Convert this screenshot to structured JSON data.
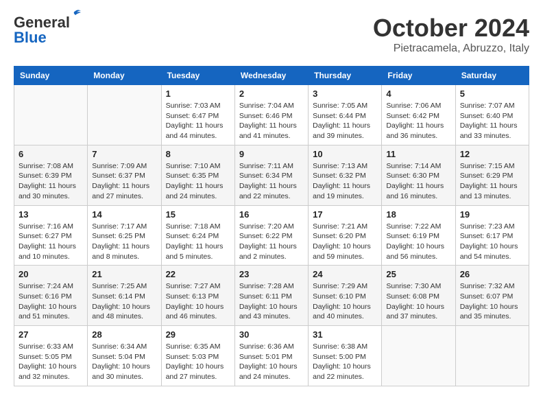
{
  "header": {
    "logo_line1": "General",
    "logo_line2": "Blue",
    "month": "October 2024",
    "location": "Pietracamela, Abruzzo, Italy"
  },
  "weekdays": [
    "Sunday",
    "Monday",
    "Tuesday",
    "Wednesday",
    "Thursday",
    "Friday",
    "Saturday"
  ],
  "weeks": [
    [
      {
        "day": "",
        "info": ""
      },
      {
        "day": "",
        "info": ""
      },
      {
        "day": "1",
        "info": "Sunrise: 7:03 AM\nSunset: 6:47 PM\nDaylight: 11 hours and 44 minutes."
      },
      {
        "day": "2",
        "info": "Sunrise: 7:04 AM\nSunset: 6:46 PM\nDaylight: 11 hours and 41 minutes."
      },
      {
        "day": "3",
        "info": "Sunrise: 7:05 AM\nSunset: 6:44 PM\nDaylight: 11 hours and 39 minutes."
      },
      {
        "day": "4",
        "info": "Sunrise: 7:06 AM\nSunset: 6:42 PM\nDaylight: 11 hours and 36 minutes."
      },
      {
        "day": "5",
        "info": "Sunrise: 7:07 AM\nSunset: 6:40 PM\nDaylight: 11 hours and 33 minutes."
      }
    ],
    [
      {
        "day": "6",
        "info": "Sunrise: 7:08 AM\nSunset: 6:39 PM\nDaylight: 11 hours and 30 minutes."
      },
      {
        "day": "7",
        "info": "Sunrise: 7:09 AM\nSunset: 6:37 PM\nDaylight: 11 hours and 27 minutes."
      },
      {
        "day": "8",
        "info": "Sunrise: 7:10 AM\nSunset: 6:35 PM\nDaylight: 11 hours and 24 minutes."
      },
      {
        "day": "9",
        "info": "Sunrise: 7:11 AM\nSunset: 6:34 PM\nDaylight: 11 hours and 22 minutes."
      },
      {
        "day": "10",
        "info": "Sunrise: 7:13 AM\nSunset: 6:32 PM\nDaylight: 11 hours and 19 minutes."
      },
      {
        "day": "11",
        "info": "Sunrise: 7:14 AM\nSunset: 6:30 PM\nDaylight: 11 hours and 16 minutes."
      },
      {
        "day": "12",
        "info": "Sunrise: 7:15 AM\nSunset: 6:29 PM\nDaylight: 11 hours and 13 minutes."
      }
    ],
    [
      {
        "day": "13",
        "info": "Sunrise: 7:16 AM\nSunset: 6:27 PM\nDaylight: 11 hours and 10 minutes."
      },
      {
        "day": "14",
        "info": "Sunrise: 7:17 AM\nSunset: 6:25 PM\nDaylight: 11 hours and 8 minutes."
      },
      {
        "day": "15",
        "info": "Sunrise: 7:18 AM\nSunset: 6:24 PM\nDaylight: 11 hours and 5 minutes."
      },
      {
        "day": "16",
        "info": "Sunrise: 7:20 AM\nSunset: 6:22 PM\nDaylight: 11 hours and 2 minutes."
      },
      {
        "day": "17",
        "info": "Sunrise: 7:21 AM\nSunset: 6:20 PM\nDaylight: 10 hours and 59 minutes."
      },
      {
        "day": "18",
        "info": "Sunrise: 7:22 AM\nSunset: 6:19 PM\nDaylight: 10 hours and 56 minutes."
      },
      {
        "day": "19",
        "info": "Sunrise: 7:23 AM\nSunset: 6:17 PM\nDaylight: 10 hours and 54 minutes."
      }
    ],
    [
      {
        "day": "20",
        "info": "Sunrise: 7:24 AM\nSunset: 6:16 PM\nDaylight: 10 hours and 51 minutes."
      },
      {
        "day": "21",
        "info": "Sunrise: 7:25 AM\nSunset: 6:14 PM\nDaylight: 10 hours and 48 minutes."
      },
      {
        "day": "22",
        "info": "Sunrise: 7:27 AM\nSunset: 6:13 PM\nDaylight: 10 hours and 46 minutes."
      },
      {
        "day": "23",
        "info": "Sunrise: 7:28 AM\nSunset: 6:11 PM\nDaylight: 10 hours and 43 minutes."
      },
      {
        "day": "24",
        "info": "Sunrise: 7:29 AM\nSunset: 6:10 PM\nDaylight: 10 hours and 40 minutes."
      },
      {
        "day": "25",
        "info": "Sunrise: 7:30 AM\nSunset: 6:08 PM\nDaylight: 10 hours and 37 minutes."
      },
      {
        "day": "26",
        "info": "Sunrise: 7:32 AM\nSunset: 6:07 PM\nDaylight: 10 hours and 35 minutes."
      }
    ],
    [
      {
        "day": "27",
        "info": "Sunrise: 6:33 AM\nSunset: 5:05 PM\nDaylight: 10 hours and 32 minutes."
      },
      {
        "day": "28",
        "info": "Sunrise: 6:34 AM\nSunset: 5:04 PM\nDaylight: 10 hours and 30 minutes."
      },
      {
        "day": "29",
        "info": "Sunrise: 6:35 AM\nSunset: 5:03 PM\nDaylight: 10 hours and 27 minutes."
      },
      {
        "day": "30",
        "info": "Sunrise: 6:36 AM\nSunset: 5:01 PM\nDaylight: 10 hours and 24 minutes."
      },
      {
        "day": "31",
        "info": "Sunrise: 6:38 AM\nSunset: 5:00 PM\nDaylight: 10 hours and 22 minutes."
      },
      {
        "day": "",
        "info": ""
      },
      {
        "day": "",
        "info": ""
      }
    ]
  ]
}
